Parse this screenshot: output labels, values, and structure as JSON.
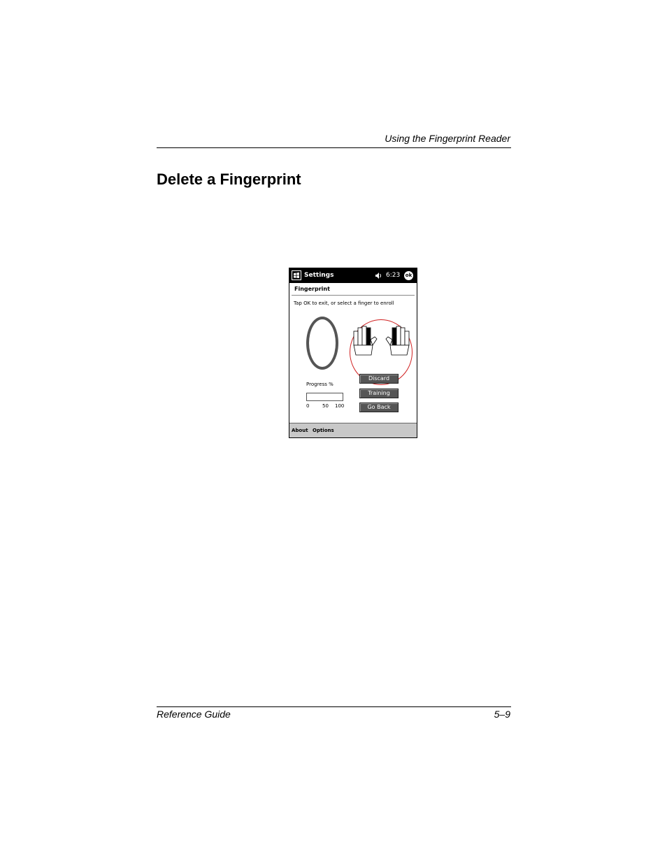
{
  "page": {
    "running_header": "Using the Fingerprint Reader",
    "title": "Delete a Fingerprint",
    "footer_left": "Reference Guide",
    "footer_right": "5–9"
  },
  "device": {
    "titlebar": {
      "start_icon": "windows-flag-icon",
      "title": "Settings",
      "speaker_icon": "speaker-icon",
      "time": "6:23",
      "ok_label": "ok"
    },
    "subheader": "Fingerprint",
    "instruction": "Tap OK to exit, or select a finger to enroll",
    "sensor_icon": "fingerprint-sensor-ring",
    "hands": {
      "left_icon": "left-hand-icon",
      "right_icon": "right-hand-icon",
      "highlight_color": "#d02020"
    },
    "buttons": {
      "discard": "Discard",
      "training": "Training",
      "go_back": "Go Back"
    },
    "progress": {
      "label": "Progress %",
      "value": 0,
      "ticks": [
        "0",
        "50",
        "100"
      ]
    },
    "menu": {
      "about": "About",
      "options": "Options"
    }
  }
}
